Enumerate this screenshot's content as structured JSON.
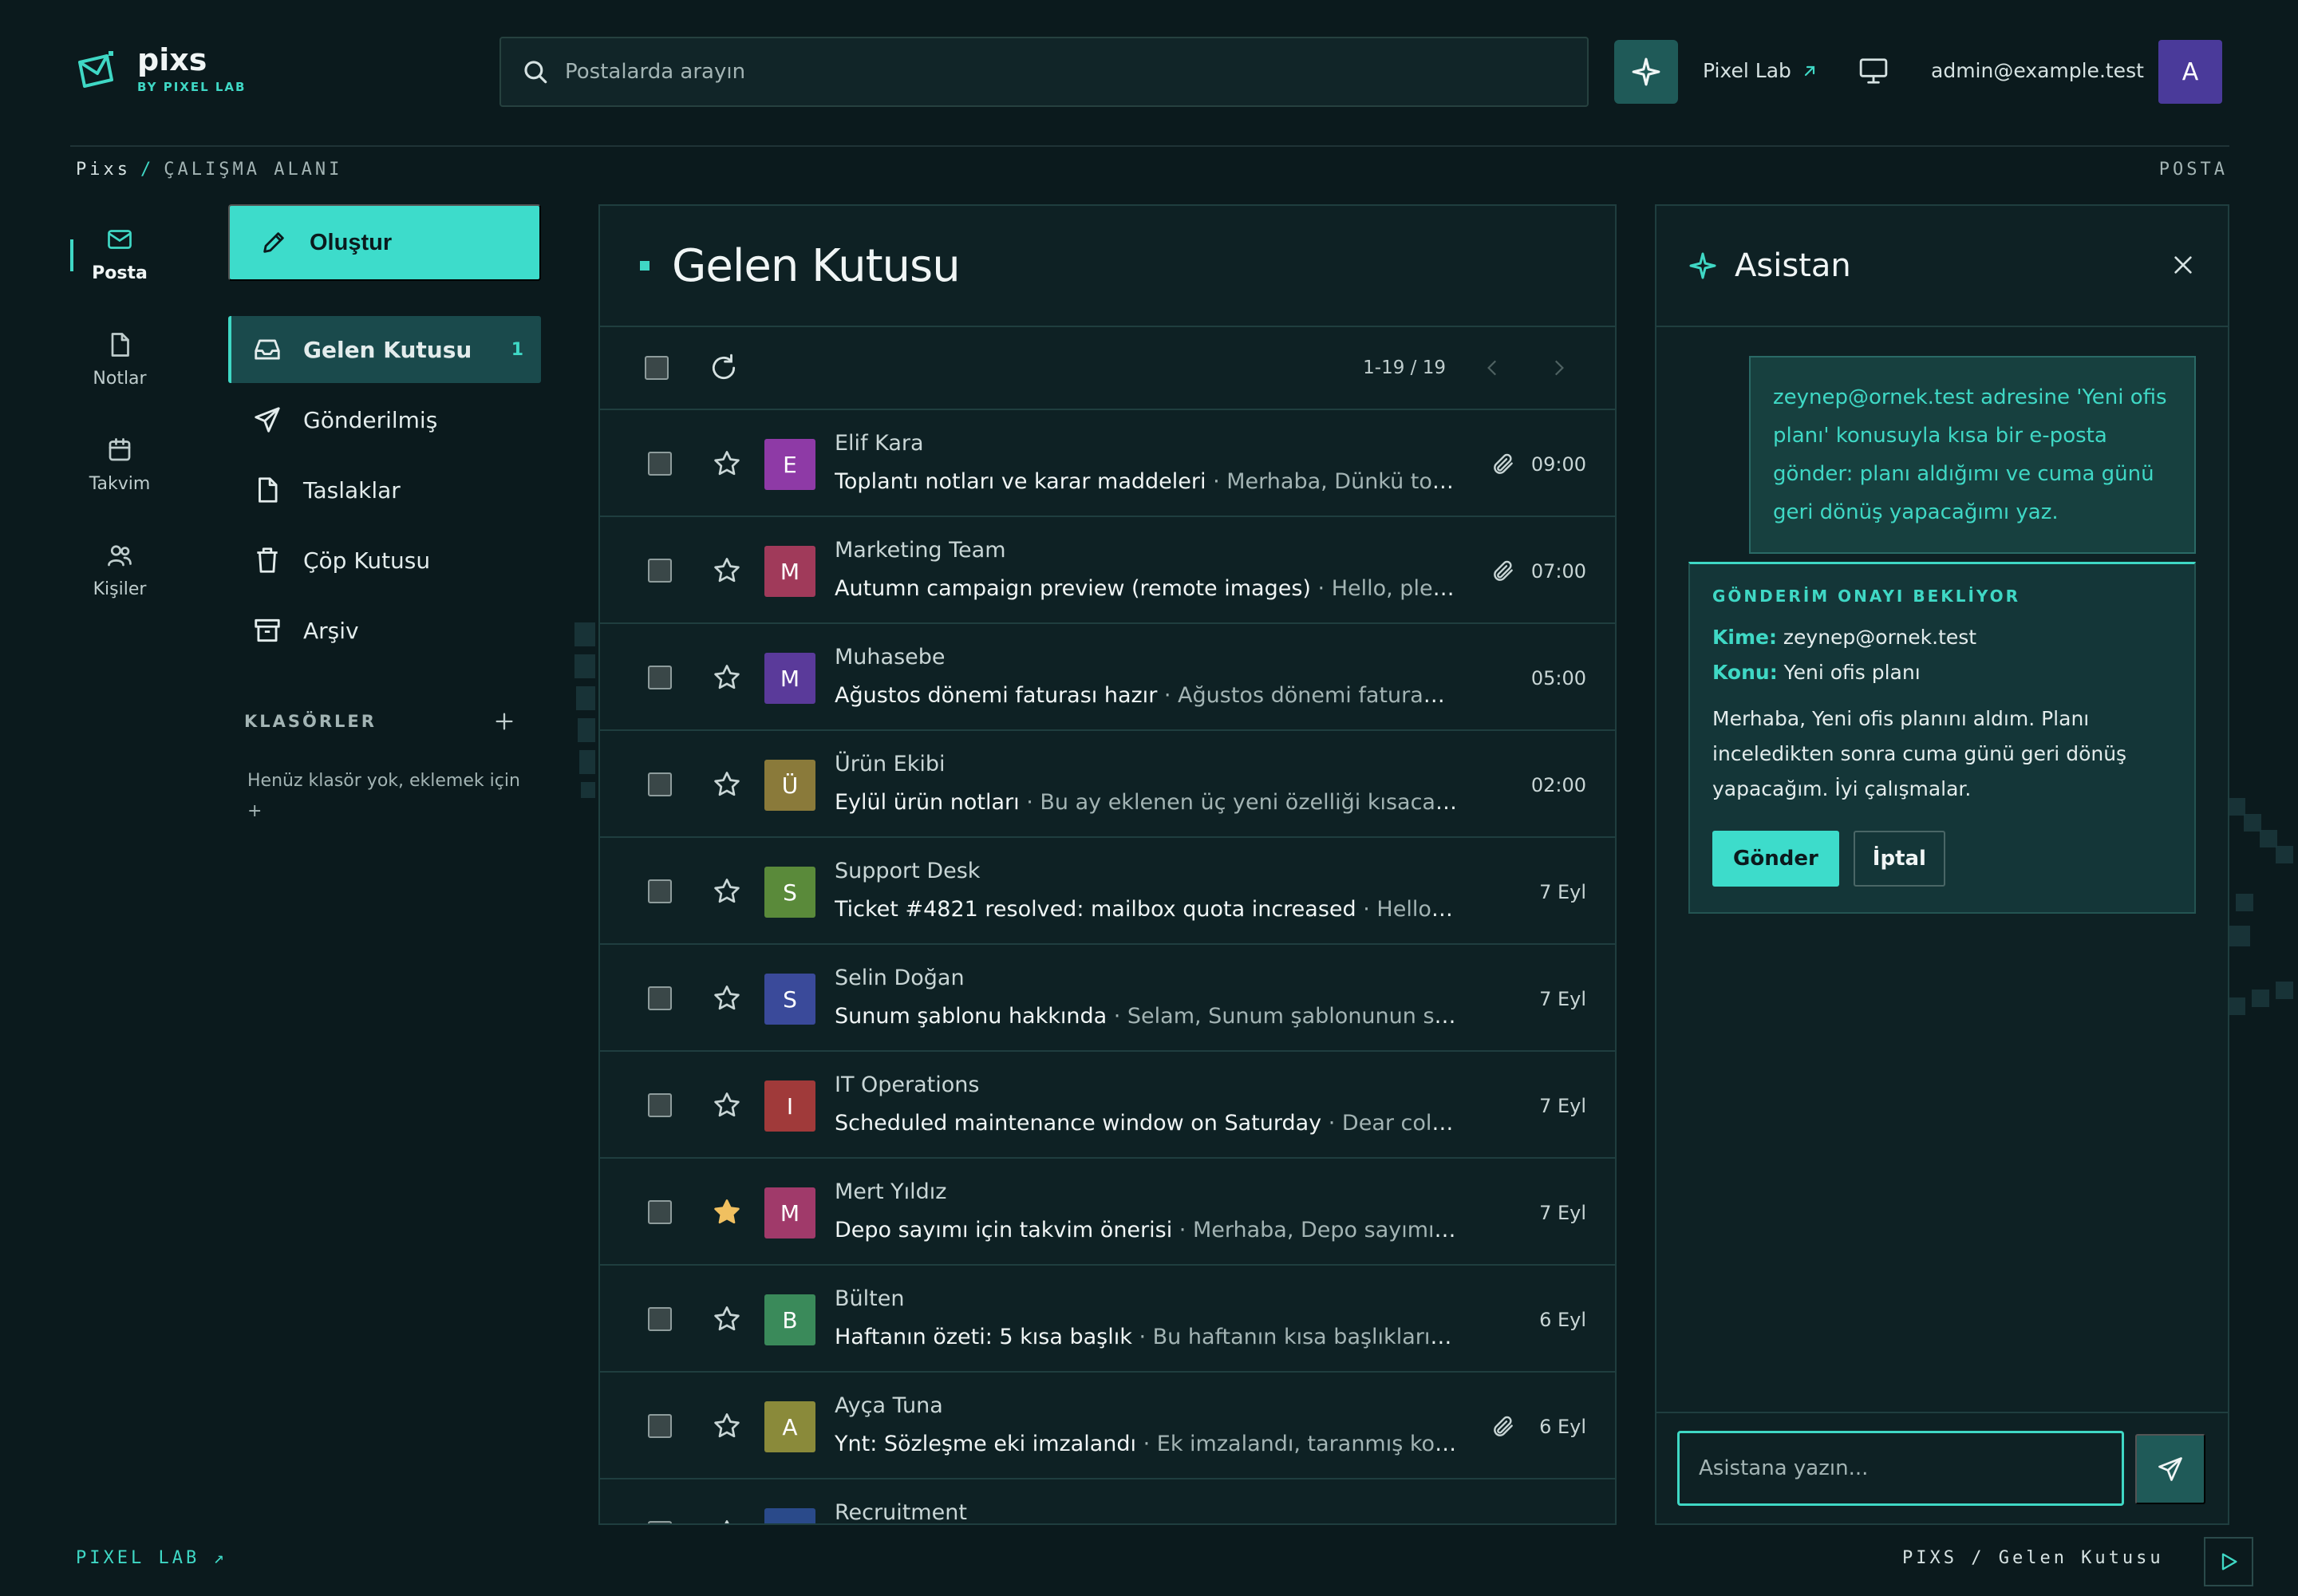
{
  "app": {
    "name": "pixs",
    "byline": "BY PIXEL LAB"
  },
  "header": {
    "search_placeholder": "Postalarda arayın",
    "link_label": "Pixel Lab",
    "user_email": "admin@example.test",
    "avatar_initial": "A"
  },
  "breadcrumb": {
    "root": "Pixs",
    "separator": "/",
    "current": "ÇALIŞMA ALANI",
    "right": "POSTA"
  },
  "rail": [
    {
      "label": "Posta",
      "icon": "mail-icon"
    },
    {
      "label": "Notlar",
      "icon": "note-icon"
    },
    {
      "label": "Takvim",
      "icon": "calendar-icon"
    },
    {
      "label": "Kişiler",
      "icon": "users-icon"
    }
  ],
  "sidebar": {
    "compose_label": "Oluştur",
    "items": [
      {
        "label": "Gelen Kutusu",
        "icon": "inbox-icon",
        "badge": "1"
      },
      {
        "label": "Gönderilmiş",
        "icon": "send-icon"
      },
      {
        "label": "Taslaklar",
        "icon": "draft-icon"
      },
      {
        "label": "Çöp Kutusu",
        "icon": "trash-icon"
      },
      {
        "label": "Arşiv",
        "icon": "archive-icon"
      }
    ],
    "folders_title": "KLASÖRLER",
    "folders_empty": "Henüz klasör yok, eklemek için +"
  },
  "mail": {
    "title": "Gelen Kutusu",
    "range": "1-19 / 19",
    "rows": [
      {
        "initial": "E",
        "color": "#8e3aa6",
        "sender": "Elif Kara",
        "subject": "Toplantı notları ve karar maddeleri",
        "preview": " · Merhaba, Dünkü toplantının notlarını ve karar maddelerini ekte paylaşıyorum.",
        "time": "09:00",
        "attachment": true,
        "starred": false
      },
      {
        "initial": "M",
        "color": "#a03a5a",
        "sender": "Marketing Team",
        "subject": "Autumn campaign preview (remote images)",
        "preview": " · Hello, please review the autumn campaign preview.",
        "time": "07:00",
        "attachment": true,
        "starred": false
      },
      {
        "initial": "M",
        "color": "#5a3a9a",
        "sender": "Muhasebe",
        "subject": "Ağustos dönemi faturası hazır",
        "preview": " · Ağustos dönemi faturanız panelde hazır.",
        "time": "05:00",
        "attachment": false,
        "starred": false
      },
      {
        "initial": "Ü",
        "color": "#8a7a3a",
        "sender": "Ürün Ekibi",
        "subject": "Eylül ürün notları",
        "preview": " · Bu ay eklenen üç yeni özelliği kısaca anlatıyoruz.",
        "time": "02:00",
        "attachment": false,
        "starred": false
      },
      {
        "initial": "S",
        "color": "#5a8a3a",
        "sender": "Support Desk",
        "subject": "Ticket #4821 resolved: mailbox quota increased",
        "preview": " · Hello, Your mailbox quota has been increased.",
        "time": "7 Eyl",
        "attachment": false,
        "starred": false
      },
      {
        "initial": "S",
        "color": "#3a4a9a",
        "sender": "Selin Doğan",
        "subject": "Sunum şablonu hakkında",
        "preview": " · Selam, Sunum şablonunun son sürümünü ekledim.",
        "time": "7 Eyl",
        "attachment": false,
        "starred": false
      },
      {
        "initial": "I",
        "color": "#a03a3a",
        "sender": "IT Operations",
        "subject": "Scheduled maintenance window on Saturday",
        "preview": " · Dear colleagues, a maintenance window is scheduled.",
        "time": "7 Eyl",
        "attachment": false,
        "starred": false
      },
      {
        "initial": "M",
        "color": "#a03a6a",
        "sender": "Mert Yıldız",
        "subject": "Depo sayımı için takvim önerisi",
        "preview": " · Merhaba, Depo sayımını 2 gün içinde planlayalım.",
        "time": "7 Eyl",
        "attachment": false,
        "starred": true
      },
      {
        "initial": "B",
        "color": "#3a8a5a",
        "sender": "Bülten",
        "subject": "Haftanın özeti: 5 kısa başlık",
        "preview": " · Bu haftanın kısa başlıkları. Abone olduğunuz için teşekkürler.",
        "time": "6 Eyl",
        "attachment": false,
        "starred": false
      },
      {
        "initial": "A",
        "color": "#8a8a3a",
        "sender": "Ayça Tuna",
        "subject": "Ynt: Sözleşme eki imzalandı",
        "preview": " · Ek imzalandı, taranmış kopya iletildi.",
        "time": "6 Eyl",
        "attachment": true,
        "starred": false
      },
      {
        "initial": "R",
        "color": "#2a4a8a",
        "sender": "Recruitment",
        "subject": "",
        "preview": "",
        "time": "",
        "attachment": false,
        "starred": false
      }
    ]
  },
  "assistant": {
    "title": "Asistan",
    "user_message": "zeynep@ornek.test adresine 'Yeni ofis planı' konusuyla kısa bir e-posta gönder: planı aldığımı ve cuma günü geri dönüş yapacağımı yaz.",
    "confirm": {
      "heading": "GÖNDERİM ONAYI BEKLİYOR",
      "to_label": "Kime:",
      "to": "zeynep@ornek.test",
      "subject_label": "Konu:",
      "subject": "Yeni ofis planı",
      "body": "Merhaba, Yeni ofis planını aldım. Planı inceledikten sonra cuma günü geri dönüş yapacağım. İyi çalışmalar.",
      "send_label": "Gönder",
      "cancel_label": "İptal"
    },
    "input_placeholder": "Asistana yazın..."
  },
  "footer": {
    "left": "PIXEL LAB ↗",
    "right": "PIXS / Gelen Kutusu"
  },
  "colors": {
    "accent": "#3fd8c5",
    "background": "#0b1a1d",
    "panel": "#0e2124",
    "star_active": "#f0c060"
  }
}
